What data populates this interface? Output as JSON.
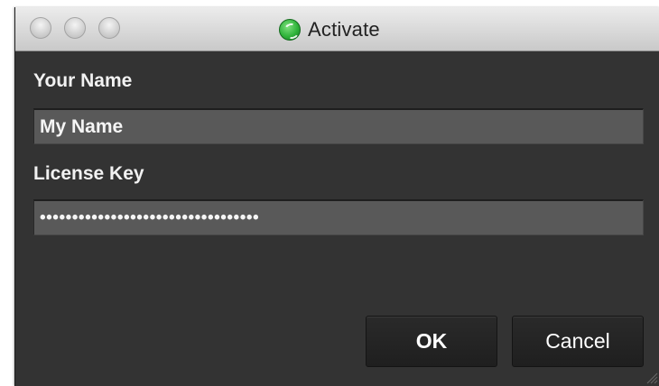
{
  "window": {
    "title": "Activate",
    "title_icon": "app-icon-green",
    "background": "#333333"
  },
  "titlebar": {
    "buttons": [
      "close",
      "minimize",
      "zoom"
    ]
  },
  "form": {
    "name_label": "Your Name",
    "name_value": "My Name",
    "key_label": "License Key",
    "key_value": "••••••••••••••••••••••••••••••••••"
  },
  "actions": {
    "ok_label": "OK",
    "cancel_label": "Cancel"
  },
  "colors": {
    "field_bg": "#595959",
    "button_bg": "#222222",
    "text": "#f2f2f2",
    "app_icon": "#2fb33a"
  }
}
